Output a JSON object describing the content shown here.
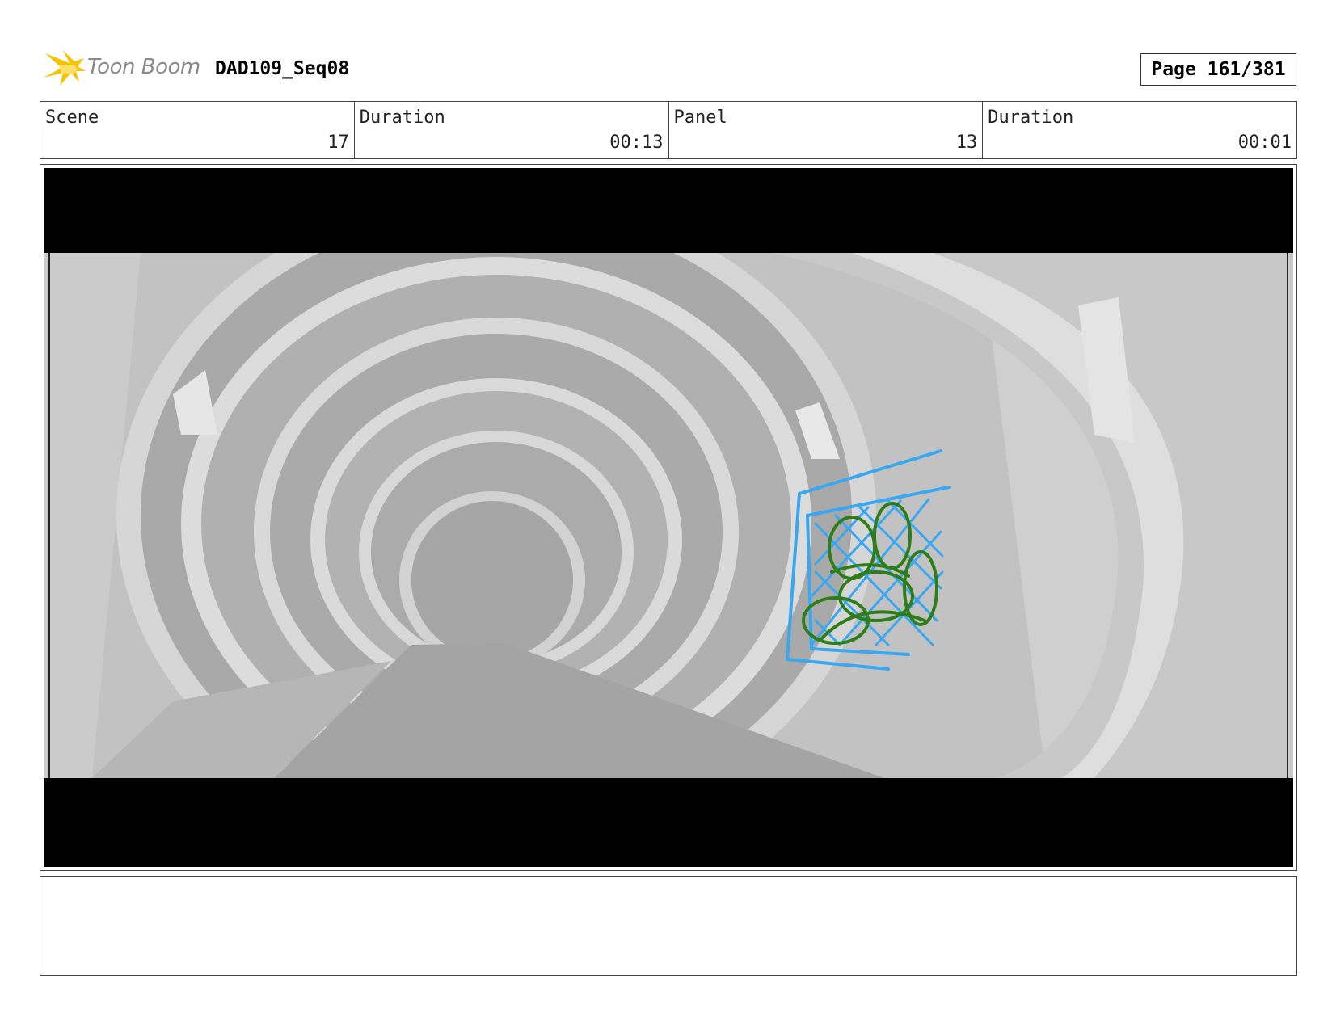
{
  "header": {
    "logo_text": "Toon Boom",
    "project": "DAD109_Seq08",
    "page": "Page 161/381"
  },
  "info": {
    "scene_label": "Scene",
    "scene_value": "17",
    "scene_duration_label": "Duration",
    "scene_duration_value": "00:13",
    "panel_label": "Panel",
    "panel_value": "13",
    "panel_duration_label": "Duration",
    "panel_duration_value": "00:01"
  },
  "notes": {
    "text": ""
  },
  "colors": {
    "logo_accent": "#f5c400",
    "sketch_blue": "#3aa8f0",
    "sketch_green": "#2e7d1a"
  }
}
